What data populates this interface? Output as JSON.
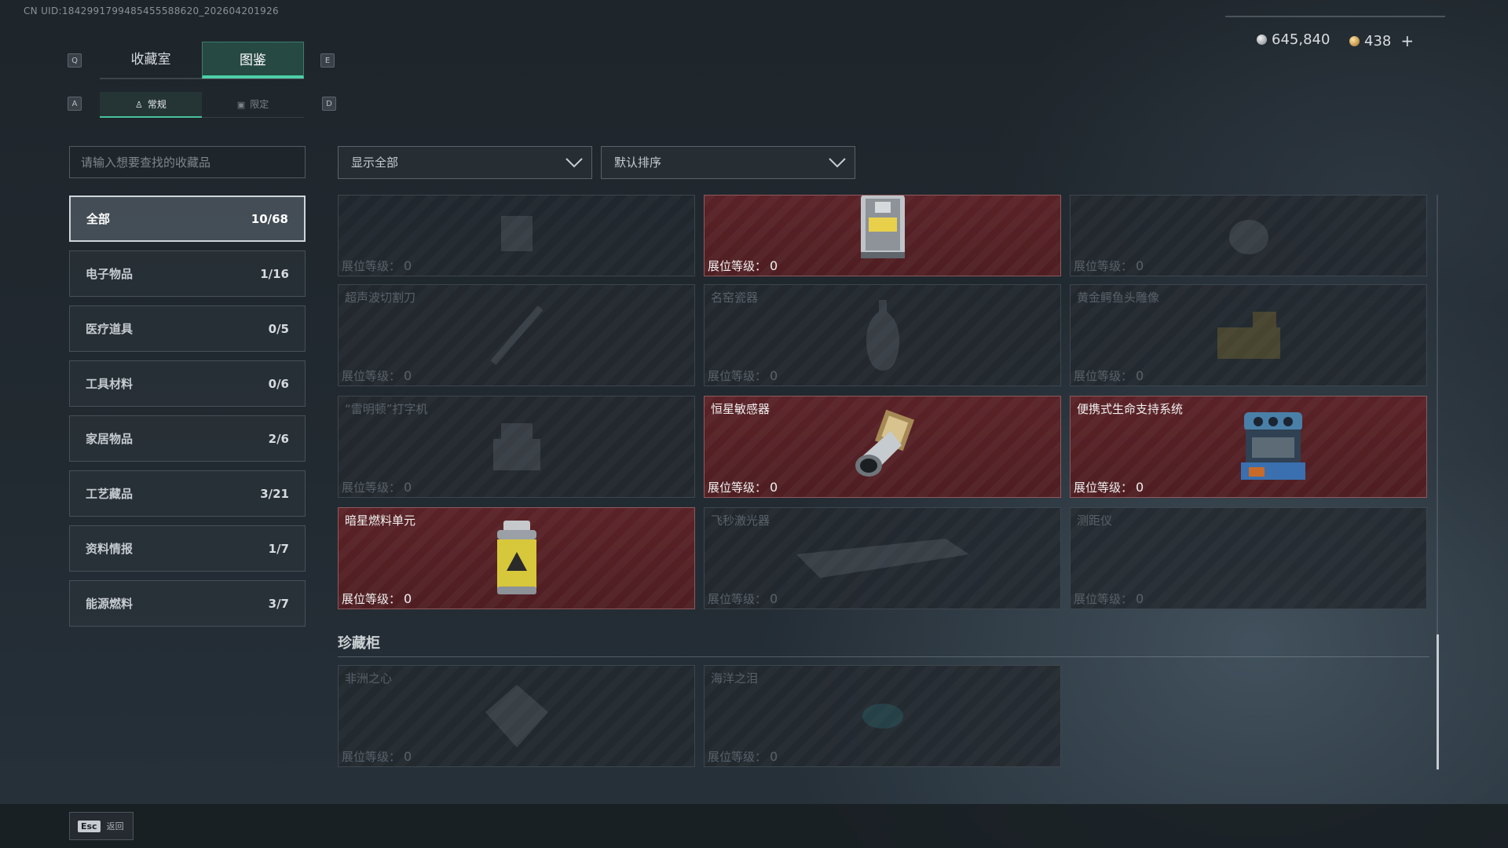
{
  "uid_text": "CN UID:1842991799485455588620_202604201926",
  "keys": {
    "q": "Q",
    "e": "E",
    "a": "A",
    "d": "D"
  },
  "tabs": {
    "collection": "收藏室",
    "atlas": "图鉴"
  },
  "subtabs": {
    "normal": "常规",
    "limited": "限定"
  },
  "currency": {
    "silver": "645,840",
    "gold": "438",
    "plus": "+"
  },
  "search": {
    "placeholder": "请输入想要查找的收藏品"
  },
  "categories": [
    {
      "label": "全部",
      "count": "10/68"
    },
    {
      "label": "电子物品",
      "count": "1/16"
    },
    {
      "label": "医疗道具",
      "count": "0/5"
    },
    {
      "label": "工具材料",
      "count": "0/6"
    },
    {
      "label": "家居物品",
      "count": "2/6"
    },
    {
      "label": "工艺藏品",
      "count": "3/21"
    },
    {
      "label": "资料情报",
      "count": "1/7"
    },
    {
      "label": "能源燃料",
      "count": "3/7"
    }
  ],
  "filters": {
    "show": "显示全部",
    "sort": "默认排序"
  },
  "level_label": "展位等级：",
  "items": [
    {
      "name": "",
      "level": "0",
      "owned": false
    },
    {
      "name": "",
      "level": "0",
      "owned": true
    },
    {
      "name": "",
      "level": "0",
      "owned": false
    },
    {
      "name": "超声波切割刀",
      "level": "0",
      "owned": false
    },
    {
      "name": "名窑瓷器",
      "level": "0",
      "owned": false
    },
    {
      "name": "黄金鳄鱼头雕像",
      "level": "0",
      "owned": false
    },
    {
      "name": "“雷明顿”打字机",
      "level": "0",
      "owned": false
    },
    {
      "name": "恒星敏感器",
      "level": "0",
      "owned": true
    },
    {
      "name": "便携式生命支持系统",
      "level": "0",
      "owned": true
    },
    {
      "name": "暗星燃料单元",
      "level": "0",
      "owned": true
    },
    {
      "name": "飞秒激光器",
      "level": "0",
      "owned": false
    },
    {
      "name": "测距仪",
      "level": "0",
      "owned": false
    }
  ],
  "treasure_section": {
    "title": "珍藏柜",
    "items": [
      {
        "name": "非洲之心",
        "level": "0",
        "owned": false
      },
      {
        "name": "海洋之泪",
        "level": "0",
        "owned": false
      }
    ]
  },
  "footer": {
    "esc_key": "Esc",
    "esc_label": "返回"
  },
  "colors": {
    "accent": "#48d2a8",
    "owned_card": "#5a2227",
    "locked_card": "#22282e"
  }
}
